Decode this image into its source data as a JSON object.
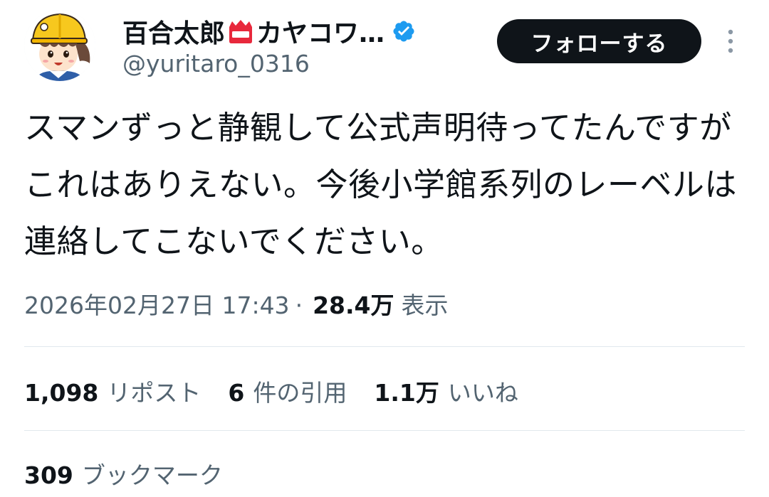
{
  "author": {
    "display_name": "百合太郎",
    "display_name_suffix": "カヤコワ…",
    "handle": "@yuritaro_0316",
    "name_emoji": "name-badge-emoji",
    "verified_icon": "verified-badge-icon",
    "avatar": "avatar-image"
  },
  "actions": {
    "follow_label": "フォローする",
    "more_icon": "more-vertical-icon"
  },
  "tweet": {
    "text": "スマンずっと静観して公式声明待ってたんですがこれはありえない。今後小学館系列のレーベルは連絡してこないでください。",
    "datetime": "2026年02月27日 17:43",
    "separator": "·",
    "views_count": "28.4万",
    "views_label": "表示"
  },
  "stats": {
    "reposts_count": "1,098",
    "reposts_label": "リポスト",
    "quotes_count": "6",
    "quotes_label": "件の引用",
    "likes_count": "1.1万",
    "likes_label": "いいね",
    "bookmarks_count": "309",
    "bookmarks_label": "ブックマーク"
  },
  "colors": {
    "text_primary": "#0f1419",
    "text_secondary": "#536471",
    "verified_blue": "#1d9bf0",
    "button_bg": "#0f1419",
    "divider": "#e1e8ed"
  }
}
